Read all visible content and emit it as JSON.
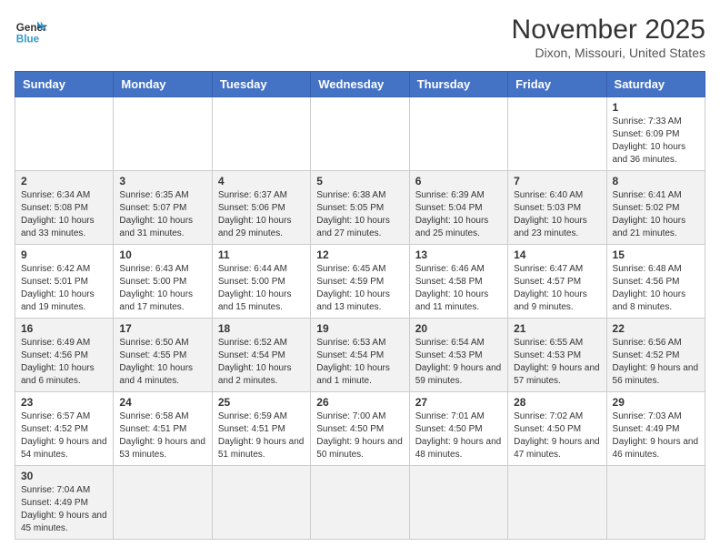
{
  "header": {
    "logo_general": "General",
    "logo_blue": "Blue",
    "month_year": "November 2025",
    "location": "Dixon, Missouri, United States"
  },
  "days_of_week": [
    "Sunday",
    "Monday",
    "Tuesday",
    "Wednesday",
    "Thursday",
    "Friday",
    "Saturday"
  ],
  "weeks": [
    [
      {
        "day": "",
        "info": ""
      },
      {
        "day": "",
        "info": ""
      },
      {
        "day": "",
        "info": ""
      },
      {
        "day": "",
        "info": ""
      },
      {
        "day": "",
        "info": ""
      },
      {
        "day": "",
        "info": ""
      },
      {
        "day": "1",
        "info": "Sunrise: 7:33 AM\nSunset: 6:09 PM\nDaylight: 10 hours and 36 minutes."
      }
    ],
    [
      {
        "day": "2",
        "info": "Sunrise: 6:34 AM\nSunset: 5:08 PM\nDaylight: 10 hours and 33 minutes."
      },
      {
        "day": "3",
        "info": "Sunrise: 6:35 AM\nSunset: 5:07 PM\nDaylight: 10 hours and 31 minutes."
      },
      {
        "day": "4",
        "info": "Sunrise: 6:37 AM\nSunset: 5:06 PM\nDaylight: 10 hours and 29 minutes."
      },
      {
        "day": "5",
        "info": "Sunrise: 6:38 AM\nSunset: 5:05 PM\nDaylight: 10 hours and 27 minutes."
      },
      {
        "day": "6",
        "info": "Sunrise: 6:39 AM\nSunset: 5:04 PM\nDaylight: 10 hours and 25 minutes."
      },
      {
        "day": "7",
        "info": "Sunrise: 6:40 AM\nSunset: 5:03 PM\nDaylight: 10 hours and 23 minutes."
      },
      {
        "day": "8",
        "info": "Sunrise: 6:41 AM\nSunset: 5:02 PM\nDaylight: 10 hours and 21 minutes."
      }
    ],
    [
      {
        "day": "9",
        "info": "Sunrise: 6:42 AM\nSunset: 5:01 PM\nDaylight: 10 hours and 19 minutes."
      },
      {
        "day": "10",
        "info": "Sunrise: 6:43 AM\nSunset: 5:00 PM\nDaylight: 10 hours and 17 minutes."
      },
      {
        "day": "11",
        "info": "Sunrise: 6:44 AM\nSunset: 5:00 PM\nDaylight: 10 hours and 15 minutes."
      },
      {
        "day": "12",
        "info": "Sunrise: 6:45 AM\nSunset: 4:59 PM\nDaylight: 10 hours and 13 minutes."
      },
      {
        "day": "13",
        "info": "Sunrise: 6:46 AM\nSunset: 4:58 PM\nDaylight: 10 hours and 11 minutes."
      },
      {
        "day": "14",
        "info": "Sunrise: 6:47 AM\nSunset: 4:57 PM\nDaylight: 10 hours and 9 minutes."
      },
      {
        "day": "15",
        "info": "Sunrise: 6:48 AM\nSunset: 4:56 PM\nDaylight: 10 hours and 8 minutes."
      }
    ],
    [
      {
        "day": "16",
        "info": "Sunrise: 6:49 AM\nSunset: 4:56 PM\nDaylight: 10 hours and 6 minutes."
      },
      {
        "day": "17",
        "info": "Sunrise: 6:50 AM\nSunset: 4:55 PM\nDaylight: 10 hours and 4 minutes."
      },
      {
        "day": "18",
        "info": "Sunrise: 6:52 AM\nSunset: 4:54 PM\nDaylight: 10 hours and 2 minutes."
      },
      {
        "day": "19",
        "info": "Sunrise: 6:53 AM\nSunset: 4:54 PM\nDaylight: 10 hours and 1 minute."
      },
      {
        "day": "20",
        "info": "Sunrise: 6:54 AM\nSunset: 4:53 PM\nDaylight: 9 hours and 59 minutes."
      },
      {
        "day": "21",
        "info": "Sunrise: 6:55 AM\nSunset: 4:53 PM\nDaylight: 9 hours and 57 minutes."
      },
      {
        "day": "22",
        "info": "Sunrise: 6:56 AM\nSunset: 4:52 PM\nDaylight: 9 hours and 56 minutes."
      }
    ],
    [
      {
        "day": "23",
        "info": "Sunrise: 6:57 AM\nSunset: 4:52 PM\nDaylight: 9 hours and 54 minutes."
      },
      {
        "day": "24",
        "info": "Sunrise: 6:58 AM\nSunset: 4:51 PM\nDaylight: 9 hours and 53 minutes."
      },
      {
        "day": "25",
        "info": "Sunrise: 6:59 AM\nSunset: 4:51 PM\nDaylight: 9 hours and 51 minutes."
      },
      {
        "day": "26",
        "info": "Sunrise: 7:00 AM\nSunset: 4:50 PM\nDaylight: 9 hours and 50 minutes."
      },
      {
        "day": "27",
        "info": "Sunrise: 7:01 AM\nSunset: 4:50 PM\nDaylight: 9 hours and 48 minutes."
      },
      {
        "day": "28",
        "info": "Sunrise: 7:02 AM\nSunset: 4:50 PM\nDaylight: 9 hours and 47 minutes."
      },
      {
        "day": "29",
        "info": "Sunrise: 7:03 AM\nSunset: 4:49 PM\nDaylight: 9 hours and 46 minutes."
      }
    ],
    [
      {
        "day": "30",
        "info": "Sunrise: 7:04 AM\nSunset: 4:49 PM\nDaylight: 9 hours and 45 minutes."
      },
      {
        "day": "",
        "info": ""
      },
      {
        "day": "",
        "info": ""
      },
      {
        "day": "",
        "info": ""
      },
      {
        "day": "",
        "info": ""
      },
      {
        "day": "",
        "info": ""
      },
      {
        "day": "",
        "info": ""
      }
    ]
  ]
}
